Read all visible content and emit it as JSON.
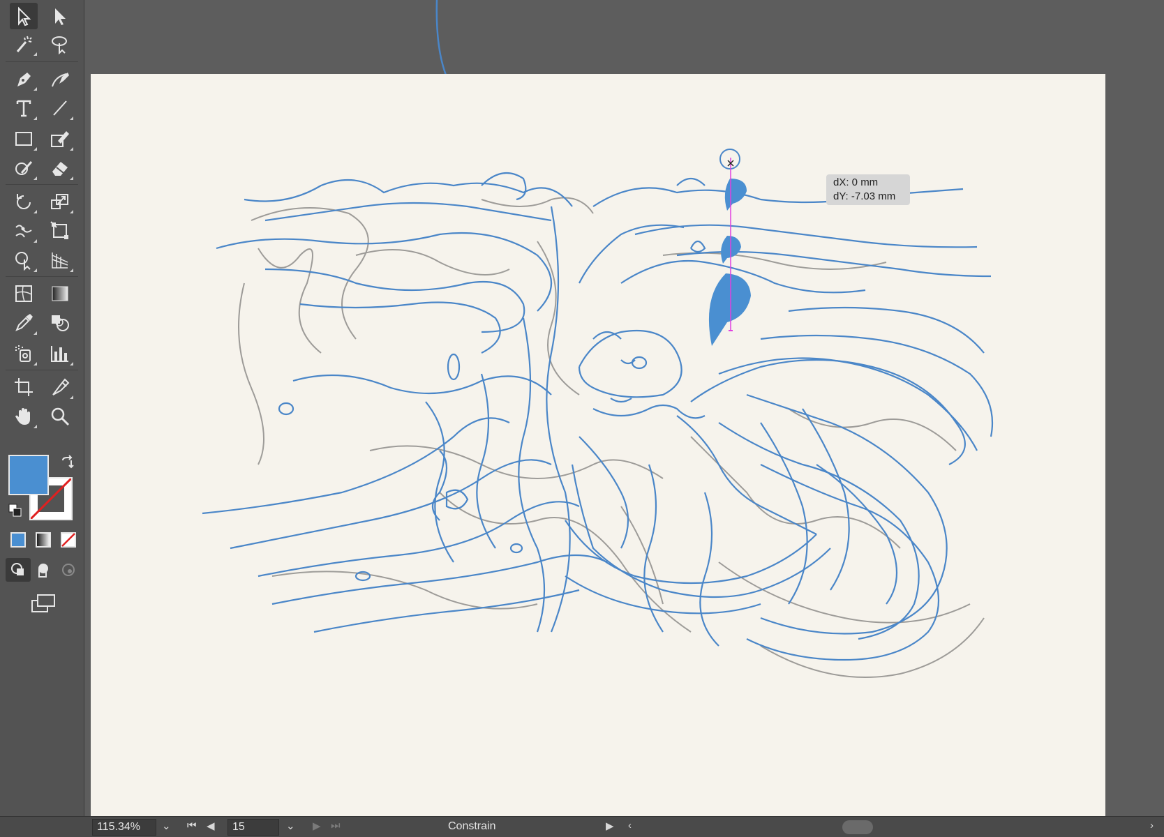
{
  "tools": [
    {
      "name": "selection-tool-icon"
    },
    {
      "name": "direct-selection-tool-icon"
    },
    {
      "name": "magic-wand-tool-icon"
    },
    {
      "name": "lasso-tool-icon"
    },
    {
      "name": "pen-tool-icon"
    },
    {
      "name": "curvature-tool-icon"
    },
    {
      "name": "type-tool-icon"
    },
    {
      "name": "line-segment-tool-icon"
    },
    {
      "name": "rectangle-tool-icon"
    },
    {
      "name": "shaper-tool-icon"
    },
    {
      "name": "blob-brush-tool-icon"
    },
    {
      "name": "eraser-tool-icon"
    },
    {
      "name": "rotate-tool-icon"
    },
    {
      "name": "scale-tool-icon"
    },
    {
      "name": "puppet-warp-tool-icon"
    },
    {
      "name": "free-transform-tool-icon"
    },
    {
      "name": "shape-builder-tool-icon"
    },
    {
      "name": "perspective-grid-tool-icon"
    },
    {
      "name": "mesh-tool-icon"
    },
    {
      "name": "gradient-tool-icon"
    },
    {
      "name": "eyedropper-tool-icon"
    },
    {
      "name": "blend-tool-icon"
    },
    {
      "name": "symbol-sprayer-tool-icon"
    },
    {
      "name": "column-graph-tool-icon"
    },
    {
      "name": "artboard-tool-icon"
    },
    {
      "name": "slice-tool-icon"
    },
    {
      "name": "hand-tool-icon"
    },
    {
      "name": "zoom-tool-icon"
    }
  ],
  "colors": {
    "fill": "#4a8fd1",
    "stroke": "none",
    "stroke_line": "#4a86c8",
    "guide": "#e040e0"
  },
  "tooltip": {
    "dx": "dX: 0 mm",
    "dy": "dY: -7.03 mm"
  },
  "statusbar": {
    "zoom": "115.34%",
    "artboard_number": "15",
    "status_text": "Constrain"
  }
}
